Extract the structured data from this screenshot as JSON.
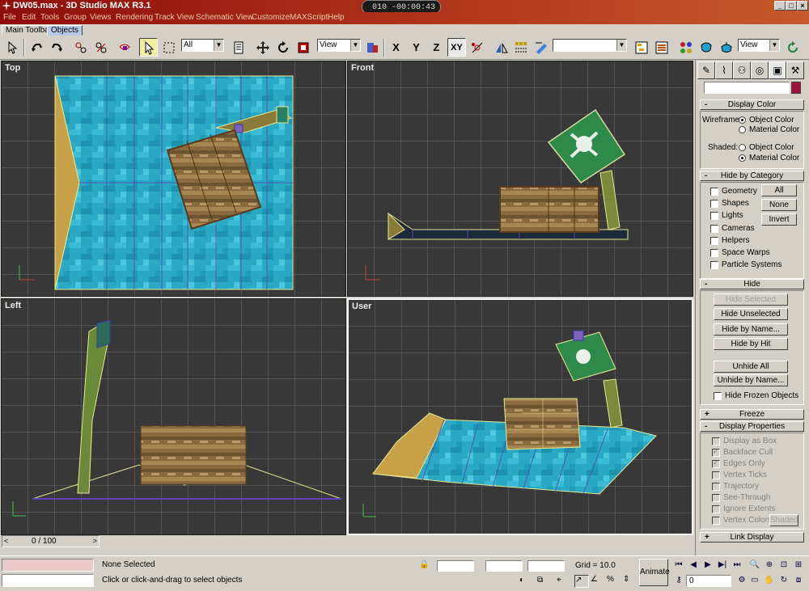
{
  "window": {
    "title": "DW05.max - 3D Studio MAX R3.1",
    "timer": "010 -00:00:43",
    "controls": {
      "minimize": "_",
      "maximize": "□",
      "close": "×"
    }
  },
  "menu": [
    "File",
    "Edit",
    "Tools",
    "Group",
    "Views",
    "Rendering",
    "Track View",
    "Schematic View",
    "Customize",
    "MAXScript",
    "Help"
  ],
  "tabs": [
    "Main Toolbar",
    "Objects"
  ],
  "toolbar": {
    "selection_filter": "All",
    "ref_coord": "View",
    "named_selection": "",
    "axis_x": "X",
    "axis_y": "Y",
    "axis_z": "Z",
    "axis_xy": "XY",
    "render_view": "View"
  },
  "viewports": {
    "top": "Top",
    "front": "Front",
    "left": "Left",
    "user": "User"
  },
  "panel": {
    "display_color": {
      "header": "Display Color",
      "wireframe_label": "Wireframe:",
      "shaded_label": "Shaded:",
      "object_color": "Object Color",
      "material_color": "Material Color",
      "wireframe_selected": "Object Color",
      "shaded_selected": "Material Color"
    },
    "hide_by_category": {
      "header": "Hide by Category",
      "items": [
        "Geometry",
        "Shapes",
        "Lights",
        "Cameras",
        "Helpers",
        "Space Warps",
        "Particle Systems"
      ],
      "buttons": [
        "All",
        "None",
        "Invert"
      ]
    },
    "hide": {
      "header": "Hide",
      "hide_selected": "Hide Selected",
      "hide_unselected": "Hide Unselected",
      "hide_by_name": "Hide by Name...",
      "hide_by_hit": "Hide by Hit",
      "unhide_all": "Unhide All",
      "unhide_by_name": "Unhide by Name...",
      "hide_frozen": "Hide Frozen Objects"
    },
    "freeze": {
      "header": "Freeze"
    },
    "display_properties": {
      "header": "Display Properties",
      "items": [
        {
          "label": "Display as Box",
          "checked": false
        },
        {
          "label": "Backface Cull",
          "checked": true
        },
        {
          "label": "Edges Only",
          "checked": true
        },
        {
          "label": "Vertex Ticks",
          "checked": false
        },
        {
          "label": "Trajectory",
          "checked": false
        },
        {
          "label": "See-Through",
          "checked": false
        },
        {
          "label": "Ignore Extents",
          "checked": false
        },
        {
          "label": "Vertex Colors",
          "checked": false
        }
      ],
      "shaded_button": "Shaded"
    },
    "link_display": {
      "header": "Link Display"
    },
    "signs": {
      "minus": "-",
      "plus": "+"
    }
  },
  "status": {
    "frame_slider": "0 / 100",
    "selection": "None Selected",
    "prompt": "Click or click-and-drag to select objects",
    "grid": "Grid = 10.0",
    "animate": "Animate",
    "frame": "0"
  },
  "colors": {
    "title_gradient_start": "#8e0d0a",
    "water": "#2aa9c4",
    "viewport_bg": "#383838",
    "grid": "#6c6c6c",
    "color_swatch": "#a0103c"
  }
}
